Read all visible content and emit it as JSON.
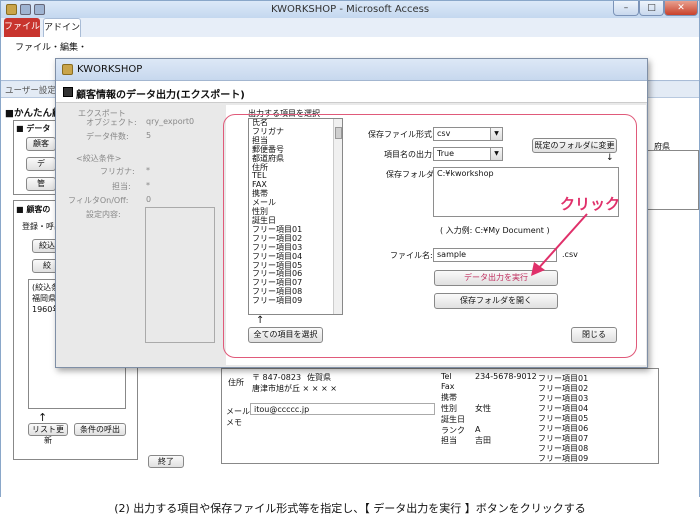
{
  "app": {
    "title": "KWORKSHOP - Microsoft Access",
    "tabs": [
      "ファイル",
      "アドイン"
    ],
    "menu": "ファイル・編集・",
    "nav_text": "ユーザー設定の..."
  },
  "window_buttons": {
    "minimize": "–",
    "maximize": "□",
    "close": "✕"
  },
  "background": {
    "form_title": "■かんたん顧",
    "section1": "■ データ",
    "btn_kokyaku": "顧客",
    "btn_de": "デ",
    "btn_kan": "管",
    "section2": "■ 顧客の",
    "reg_label": "登録・呼出",
    "btn_shibo": "絞込",
    "btn_nari": "絞",
    "filter_label": "(絞込条",
    "filter_v1": "福岡県",
    "filter_v2": "1960年",
    "arrow": "↑",
    "btn_refresh": "リスト更新",
    "btn_recall": "条件の呼出",
    "btn_exit": "終了",
    "right_col_header": "府県",
    "record": {
      "addr_label": "住所",
      "zip": "〒 847-0823",
      "pref": "佐賀県",
      "addr": "唐津市旭が丘 × × × ×",
      "mail_label": "メール",
      "mail": "itou@ccccc.jp",
      "memo_label": "メモ",
      "tel_label": "Tel",
      "tel": "234-5678-9012",
      "fax_label": "Fax",
      "mobile_label": "携帯",
      "sex_label": "性別",
      "sex": "女性",
      "birthday_label": "誕生日",
      "rank_label": "ランク",
      "rank": "A",
      "staff_label": "担当",
      "staff": "吉田",
      "free": [
        "フリー項目01",
        "フリー項目02",
        "フリー項目03",
        "フリー項目04",
        "フリー項目05",
        "フリー項目06",
        "フリー項目07",
        "フリー項目08",
        "フリー項目09"
      ]
    }
  },
  "dialog": {
    "title": "KWORKSHOP",
    "header": "顧客情報のデータ出力(エクスポート)",
    "export_label": "エクスポート",
    "object_label": "オブジェクト:",
    "object_value": "qry_export0",
    "count_label": "データ件数:",
    "count_value": "5",
    "filter_header": "<絞込条件>",
    "furigana_label": "フリガナ:",
    "furigana_value": "*",
    "tanto_label": "担当:",
    "tanto_value": "*",
    "filter_onoff_label": "フィルタOn/Off:",
    "filter_onoff_value": "0",
    "settings_label": "設定内容:",
    "list_label": "出力する項目を選択",
    "items": [
      "氏名",
      "フリガナ",
      "担当",
      "郵便番号",
      "都道府県",
      "住所",
      "TEL",
      "FAX",
      "携帯",
      "メール",
      "性別",
      "誕生日",
      "フリー項目01",
      "フリー項目02",
      "フリー項目03",
      "フリー項目04",
      "フリー項目05",
      "フリー項目06",
      "フリー項目07",
      "フリー項目08",
      "フリー項目09"
    ],
    "select_all": "全ての項目を選択",
    "format_label": "保存ファイル形式:",
    "format_value": "csv",
    "header_out_label": "項目名の出力:",
    "header_out_value": "True",
    "default_folder_btn": "既定のフォルダに変更",
    "folder_label": "保存フォルダ:",
    "folder_value": "C:¥kworkshop",
    "folder_hint": "( 入力例: C:¥My Document )",
    "filename_label": "ファイル名:",
    "filename_value": "sample",
    "ext": ".csv",
    "run_btn": "データ出力を実行",
    "open_folder_btn": "保存フォルダを開く",
    "close_btn": "閉じる",
    "click_label": "クリック"
  },
  "caption": "(2) 出力する項目や保存ファイル形式等を指定し、【 データ出力を実行 】ボタンをクリックする"
}
